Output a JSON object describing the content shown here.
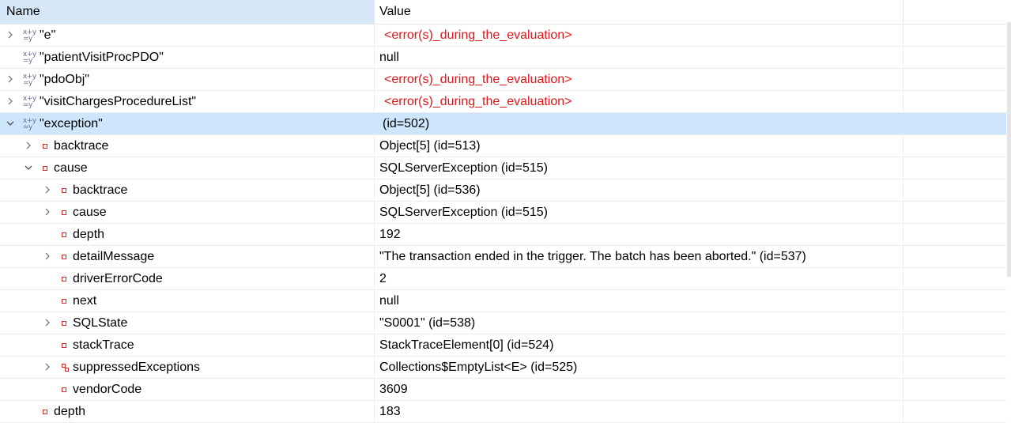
{
  "columns": {
    "name": "Name",
    "value": "Value"
  },
  "rows": [
    {
      "name": "\"e\"",
      "value": "<error(s)_during_the_evaluation>"
    },
    {
      "name": "\"patientVisitProcPDO\"",
      "value": "null"
    },
    {
      "name": "\"pdoObj\"",
      "value": "<error(s)_during_the_evaluation>"
    },
    {
      "name": "\"visitChargesProcedureList\"",
      "value": "<error(s)_during_the_evaluation>"
    },
    {
      "name": "\"exception\"",
      "value": "(id=502)"
    },
    {
      "name": "backtrace",
      "value": "Object[5]  (id=513)"
    },
    {
      "name": "cause",
      "value": "SQLServerException  (id=515)"
    },
    {
      "name": "backtrace",
      "value": "Object[5]  (id=536)"
    },
    {
      "name": "cause",
      "value": "SQLServerException  (id=515)"
    },
    {
      "name": "depth",
      "value": "192"
    },
    {
      "name": "detailMessage",
      "value": "\"The transaction ended in the trigger. The batch has been aborted.\" (id=537)"
    },
    {
      "name": "driverErrorCode",
      "value": "2"
    },
    {
      "name": "next",
      "value": "null"
    },
    {
      "name": "SQLState",
      "value": "\"S0001\" (id=538)"
    },
    {
      "name": "stackTrace",
      "value": "StackTraceElement[0]  (id=524)"
    },
    {
      "name": "suppressedExceptions",
      "value": "Collections$EmptyList<E>  (id=525)"
    },
    {
      "name": "vendorCode",
      "value": "3609"
    },
    {
      "name": "depth",
      "value": "183"
    }
  ],
  "variable_icon_text": "x+y\n=y"
}
